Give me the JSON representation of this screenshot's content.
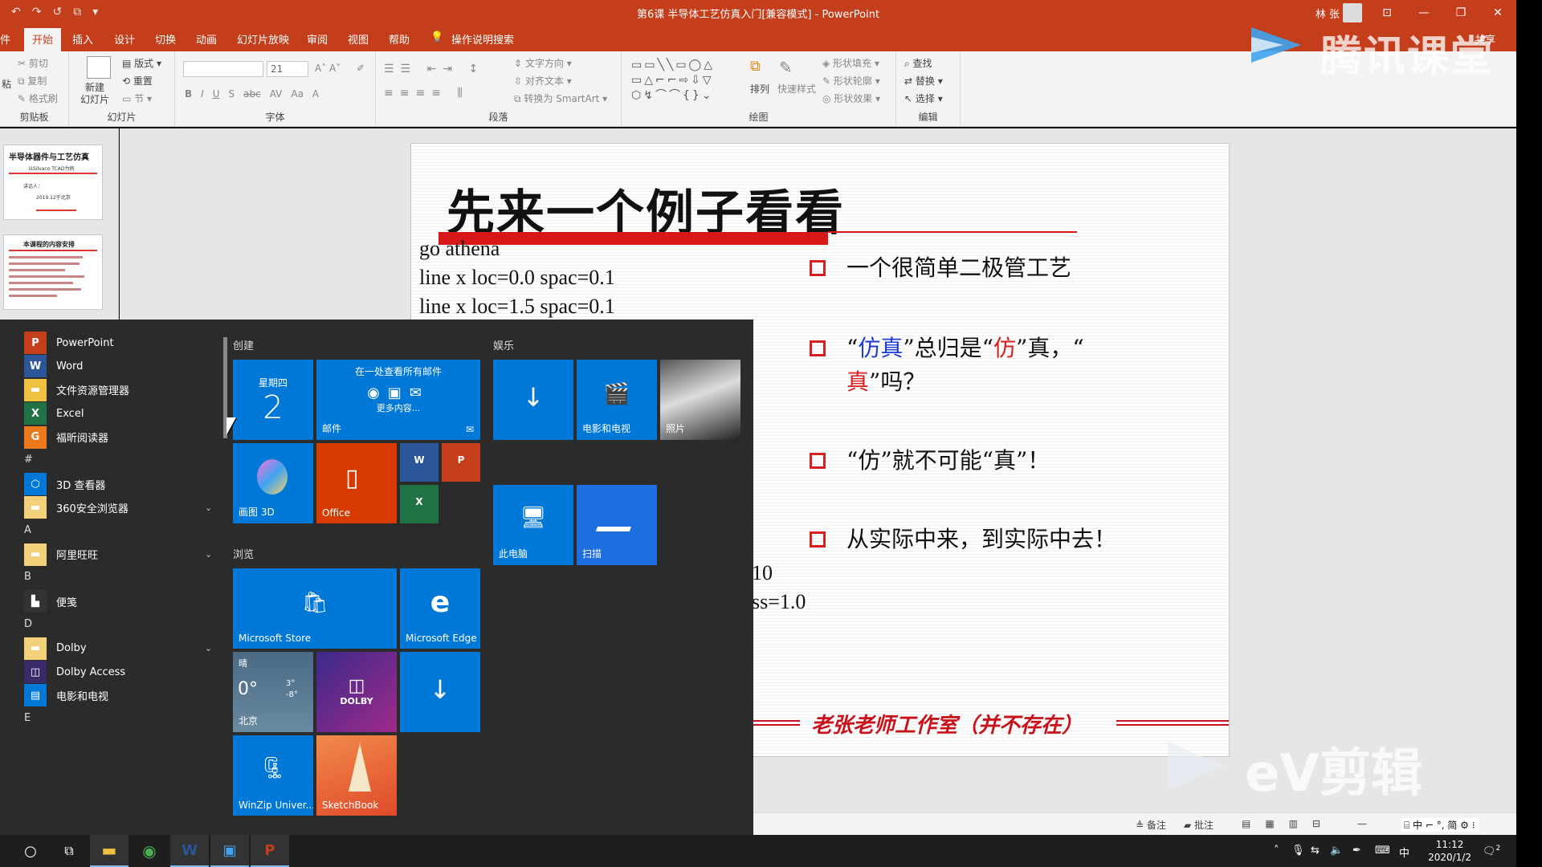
{
  "window": {
    "title": "第6课 半导体工艺仿真入门[兼容模式] - PowerPoint",
    "user": "林 张",
    "quick_access": [
      "↶",
      "↷",
      "↺",
      "⧉",
      "▾"
    ],
    "controls": [
      "⊡",
      "—",
      "❐",
      "✕"
    ]
  },
  "tabs": [
    "件",
    "开始",
    "插入",
    "设计",
    "切换",
    "动画",
    "幻灯片放映",
    "审阅",
    "视图",
    "帮助",
    "操作说明搜索"
  ],
  "active_tab": "开始",
  "share_label": "共享",
  "ribbon": {
    "clipboard": {
      "label": "剪贴板",
      "paste": "粘",
      "cut": "剪切",
      "copy": "复制",
      "format_painter": "格式刷"
    },
    "slides": {
      "label": "幻灯片",
      "new_slide": "新建\n幻灯片",
      "layout": "版式",
      "reset": "重置",
      "section": "节"
    },
    "font": {
      "label": "字体",
      "font_size": "21",
      "buttons": [
        "B",
        "I",
        "U",
        "S",
        "abc",
        "AV",
        "Aa",
        "A"
      ]
    },
    "paragraph": {
      "label": "段落",
      "text_direction": "文字方向",
      "align_text": "对齐文本",
      "smartart": "转换为 SmartArt"
    },
    "drawing": {
      "label": "绘图",
      "arrange": "排列",
      "quick_styles": "快速样式",
      "fill": "形状填充",
      "outline": "形状轮廓",
      "effects": "形状效果"
    },
    "editing": {
      "label": "编辑",
      "find": "查找",
      "replace": "替换",
      "select": "选择"
    }
  },
  "thumbnails": [
    {
      "title": "半导体器件与工艺仿真",
      "subtitle": "以Silvaco TCAD为例",
      "line3": "讲话人：",
      "date": "2019.12于北京"
    },
    {
      "title": "本课程的内容安排"
    }
  ],
  "slide": {
    "title": "先来一个例子看看",
    "code_lines": [
      "go athena",
      "line x loc=0.0 spac=0.1",
      "line x loc=1.5 spac=0.1"
    ],
    "code_fragments": [
      "10",
      "ss=1.0"
    ],
    "bullets": [
      {
        "parts": [
          {
            "t": "一个很简单二极管工艺",
            "c": ""
          }
        ]
      },
      {
        "parts": [
          {
            "t": "“",
            "c": ""
          },
          {
            "t": "仿真",
            "c": "blue"
          },
          {
            "t": "”总归是“",
            "c": ""
          },
          {
            "t": "仿",
            "c": "red"
          },
          {
            "t": "”真，“",
            "c": ""
          },
          {
            "t": "真",
            "c": "red"
          },
          {
            "t": "”吗？",
            "c": ""
          }
        ]
      },
      {
        "parts": [
          {
            "t": "“仿”就不可能“真”！",
            "c": ""
          }
        ]
      },
      {
        "parts": [
          {
            "t": "从实际中来，到实际中去！",
            "c": ""
          }
        ]
      }
    ],
    "studio": "老张老师工作室（并不存在）"
  },
  "status": {
    "notes": "备注",
    "comments": "批注",
    "ime": "中 ⌐ °, 简"
  },
  "watermarks": {
    "tencent": "腾讯课堂",
    "ev": "eV剪辑"
  },
  "start_menu": {
    "apps": [
      {
        "type": "app",
        "name": "PowerPoint",
        "icon": "P",
        "color": "#c43e1c"
      },
      {
        "type": "app",
        "name": "Word",
        "icon": "W",
        "color": "#2b579a"
      },
      {
        "type": "app",
        "name": "文件资源管理器",
        "icon": "▬",
        "color": "#f0c040"
      },
      {
        "type": "app",
        "name": "Excel",
        "icon": "X",
        "color": "#217346"
      },
      {
        "type": "app",
        "name": "福昕阅读器",
        "icon": "G",
        "color": "#ec7a1c"
      },
      {
        "type": "letter",
        "name": "#"
      },
      {
        "type": "app",
        "name": "3D 查看器",
        "icon": "⬡",
        "color": "#0078d7"
      },
      {
        "type": "app",
        "name": "360安全浏览器",
        "icon": "▬",
        "color": "#f3d07a",
        "chev": true
      },
      {
        "type": "letter",
        "name": "A"
      },
      {
        "type": "app",
        "name": "阿里旺旺",
        "icon": "▬",
        "color": "#f3d07a",
        "chev": true
      },
      {
        "type": "letter",
        "name": "B"
      },
      {
        "type": "app",
        "name": "便笺",
        "icon": "▙",
        "color": "#333"
      },
      {
        "type": "letter",
        "name": "D"
      },
      {
        "type": "app",
        "name": "Dolby",
        "icon": "▬",
        "color": "#f3d07a",
        "chev": true
      },
      {
        "type": "app",
        "name": "Dolby Access",
        "icon": "◫",
        "color": "#3a2a6a"
      },
      {
        "type": "app",
        "name": "电影和电视",
        "icon": "▤",
        "color": "#0078d7"
      },
      {
        "type": "letter",
        "name": "E"
      }
    ],
    "sections": {
      "create": "创建",
      "play": "娱乐",
      "explore": "浏览"
    },
    "tiles": {
      "calendar_day": "星期四",
      "calendar_date": "2",
      "mail_header": "在一处查看所有邮件",
      "mail_more": "更多内容...",
      "mail": "邮件",
      "paint3d": "画图 3D",
      "office": "Office",
      "movies": "电影和电视",
      "photos": "照片",
      "this_pc": "此电脑",
      "scan": "扫描",
      "store": "Microsoft Store",
      "edge": "Microsoft Edge",
      "weather_cond": "晴",
      "weather_temp": "0°",
      "weather_hi": "3°",
      "weather_lo": "-8°",
      "weather_city": "北京",
      "dolby": "DOLBY",
      "winzip": "WinZip Univer...",
      "sketchbook": "SketchBook"
    }
  },
  "taskbar": {
    "time": "11:12",
    "date": "2020/1/2",
    "ime": "中",
    "notif": "2"
  }
}
